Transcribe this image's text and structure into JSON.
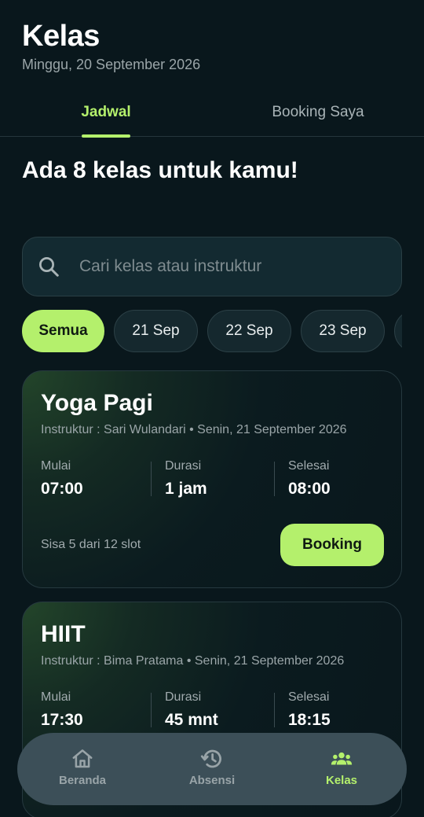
{
  "header": {
    "title": "Kelas",
    "date": "Minggu, 20 September 2026"
  },
  "tabs": [
    {
      "label": "Jadwal",
      "active": true
    },
    {
      "label": "Booking Saya",
      "active": false
    }
  ],
  "headline": "Ada 8 kelas untuk kamu!",
  "search": {
    "placeholder": "Cari kelas atau instruktur",
    "icon": "search-icon"
  },
  "filters": [
    {
      "label": "Semua",
      "active": true
    },
    {
      "label": "21 Sep",
      "active": false
    },
    {
      "label": "22 Sep",
      "active": false
    },
    {
      "label": "23 Sep",
      "active": false
    }
  ],
  "classes": [
    {
      "title": "Yoga Pagi",
      "subtitle": "Instruktur : Sari Wulandari • Senin, 21 September 2026",
      "start_label": "Mulai",
      "start": "07:00",
      "duration_label": "Durasi",
      "duration": "1 jam",
      "end_label": "Selesai",
      "end": "08:00",
      "slots": "Sisa 5 dari 12 slot",
      "button": "Booking"
    },
    {
      "title": "HIIT",
      "subtitle": "Instruktur : Bima Pratama • Senin, 21 September 2026",
      "start_label": "Mulai",
      "start": "17:30",
      "duration_label": "Durasi",
      "duration": "45 mnt",
      "end_label": "Selesai",
      "end": "18:15"
    }
  ],
  "bottom_nav": [
    {
      "label": "Beranda",
      "icon": "home-icon",
      "active": false
    },
    {
      "label": "Absensi",
      "icon": "history-icon",
      "active": false
    },
    {
      "label": "Kelas",
      "icon": "group-icon",
      "active": true
    }
  ],
  "colors": {
    "background": "#09171c",
    "accent": "#b4f06c",
    "muted_text": "#9aa5a8",
    "nav_background": "#3c4f58"
  }
}
